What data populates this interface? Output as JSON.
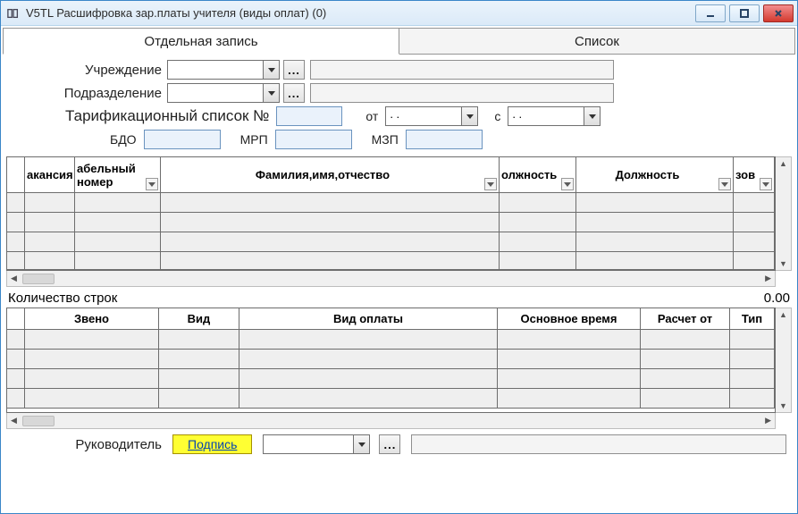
{
  "window": {
    "title": "V5TL Расшифровка зар.платы учителя (виды оплат) (0)"
  },
  "tabs": {
    "active": "Отдельная запись",
    "inactive": "Список"
  },
  "form": {
    "institution_label": "Учреждение",
    "institution_value": "",
    "institution_display": "",
    "department_label": "Подразделение",
    "department_value": "",
    "department_display": "",
    "tariff_label": "Тарификационный список №",
    "tariff_no": "",
    "from_label": "от",
    "from_value": " .  . ",
    "since_label": "с",
    "since_value": " .  . ",
    "bdo_label": "БДО",
    "bdo_value": "",
    "mrp_label": "МРП",
    "mrp_value": "",
    "mzp_label": "МЗП",
    "mzp_value": ""
  },
  "grid1": {
    "columns": {
      "c0": "",
      "c1": "акансия",
      "c2": "абельный номер",
      "c3": "Фамилия,имя,отчество",
      "c4": "олжность",
      "c5": "Должность",
      "c6": "зов"
    }
  },
  "count": {
    "label": "Количество строк",
    "value": "0.00"
  },
  "grid2": {
    "columns": {
      "c0": "",
      "c1": "Звено",
      "c2": "Вид",
      "c3": "Вид оплаты",
      "c4": "Основное время",
      "c5": "Расчет от",
      "c6": "Тип"
    }
  },
  "sign": {
    "label": "Руководитель",
    "button": "Подпись",
    "value": "",
    "display": ""
  }
}
